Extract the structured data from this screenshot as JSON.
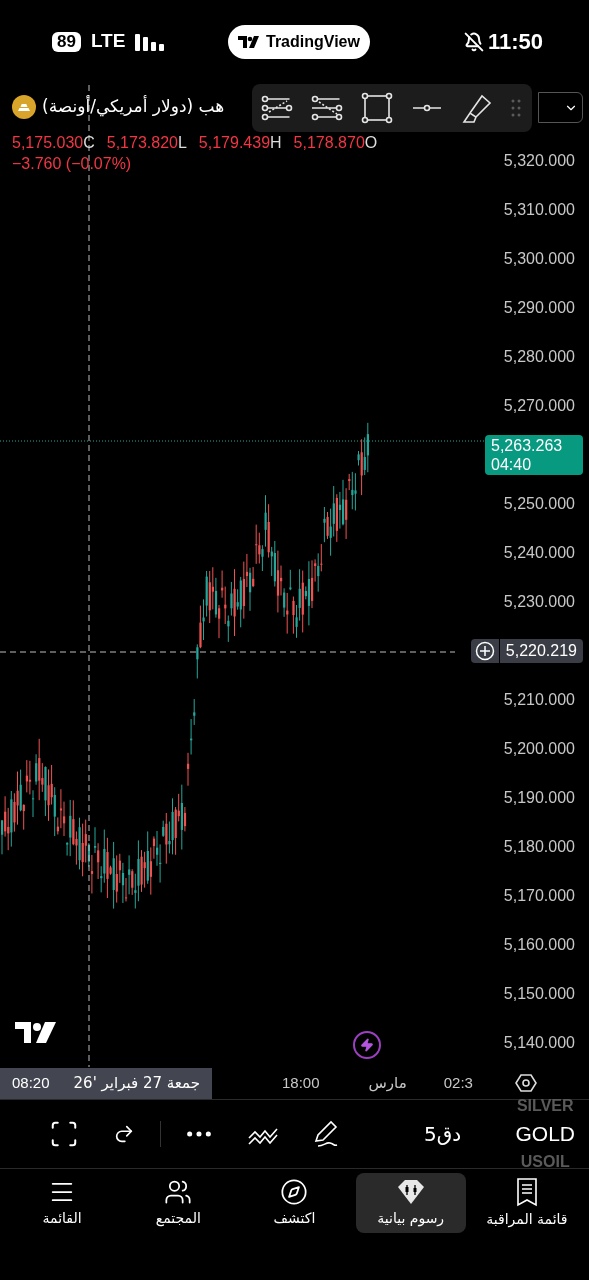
{
  "status_bar": {
    "battery": "89",
    "network": "LTE",
    "app_pill": "TradingView",
    "time": "11:50"
  },
  "symbol": {
    "title": "هب (دولار أمريكي/أونصة)",
    "ohlc": [
      "5,175.030C",
      "5,173.820L",
      "5,179.439H",
      "5,178.870O"
    ],
    "change": "−3.760 (−0.07%)"
  },
  "price_axis": [
    {
      "kind": "tick",
      "text": "5,320.000"
    },
    {
      "kind": "tick",
      "text": "5,310.000"
    },
    {
      "kind": "tick",
      "text": "5,300.000"
    },
    {
      "kind": "tick",
      "text": "5,290.000"
    },
    {
      "kind": "tick",
      "text": "5,280.000"
    },
    {
      "kind": "tick",
      "text": "5,270.000"
    },
    {
      "kind": "last_price",
      "text": "5,263.263",
      "countdown": "04:40"
    },
    {
      "kind": "tick",
      "text": "5,250.000"
    },
    {
      "kind": "tick",
      "text": "5,240.000"
    },
    {
      "kind": "tick",
      "text": "5,230.000"
    },
    {
      "kind": "crosshair",
      "text": "5,220.219"
    },
    {
      "kind": "tick",
      "text": "5,210.000"
    },
    {
      "kind": "tick",
      "text": "5,200.000"
    },
    {
      "kind": "tick",
      "text": "5,190.000"
    },
    {
      "kind": "tick",
      "text": "5,180.000"
    },
    {
      "kind": "tick",
      "text": "5,170.000"
    },
    {
      "kind": "tick",
      "text": "5,160.000"
    },
    {
      "kind": "tick",
      "text": "5,150.000"
    },
    {
      "kind": "tick",
      "text": "5,140.000"
    }
  ],
  "time_axis": {
    "crosshair_date": "جمعة 27 فبراير '26",
    "crosshair_time": "08:20",
    "labels": [
      "18:00",
      "مارس",
      "02:3"
    ]
  },
  "toolbar": {
    "interval": "5دق",
    "symbols": [
      {
        "label": "SILVER",
        "selected": false
      },
      {
        "label": "GOLD",
        "selected": true
      },
      {
        "label": "USOIL",
        "selected": false
      }
    ]
  },
  "nav": [
    {
      "label": "قائمة المراقبة",
      "selected": false
    },
    {
      "label": "رسوم بيانية",
      "selected": true
    },
    {
      "label": "اكتشف",
      "selected": false
    },
    {
      "label": "المجتمع",
      "selected": false
    },
    {
      "label": "القائمة",
      "selected": false
    }
  ]
}
